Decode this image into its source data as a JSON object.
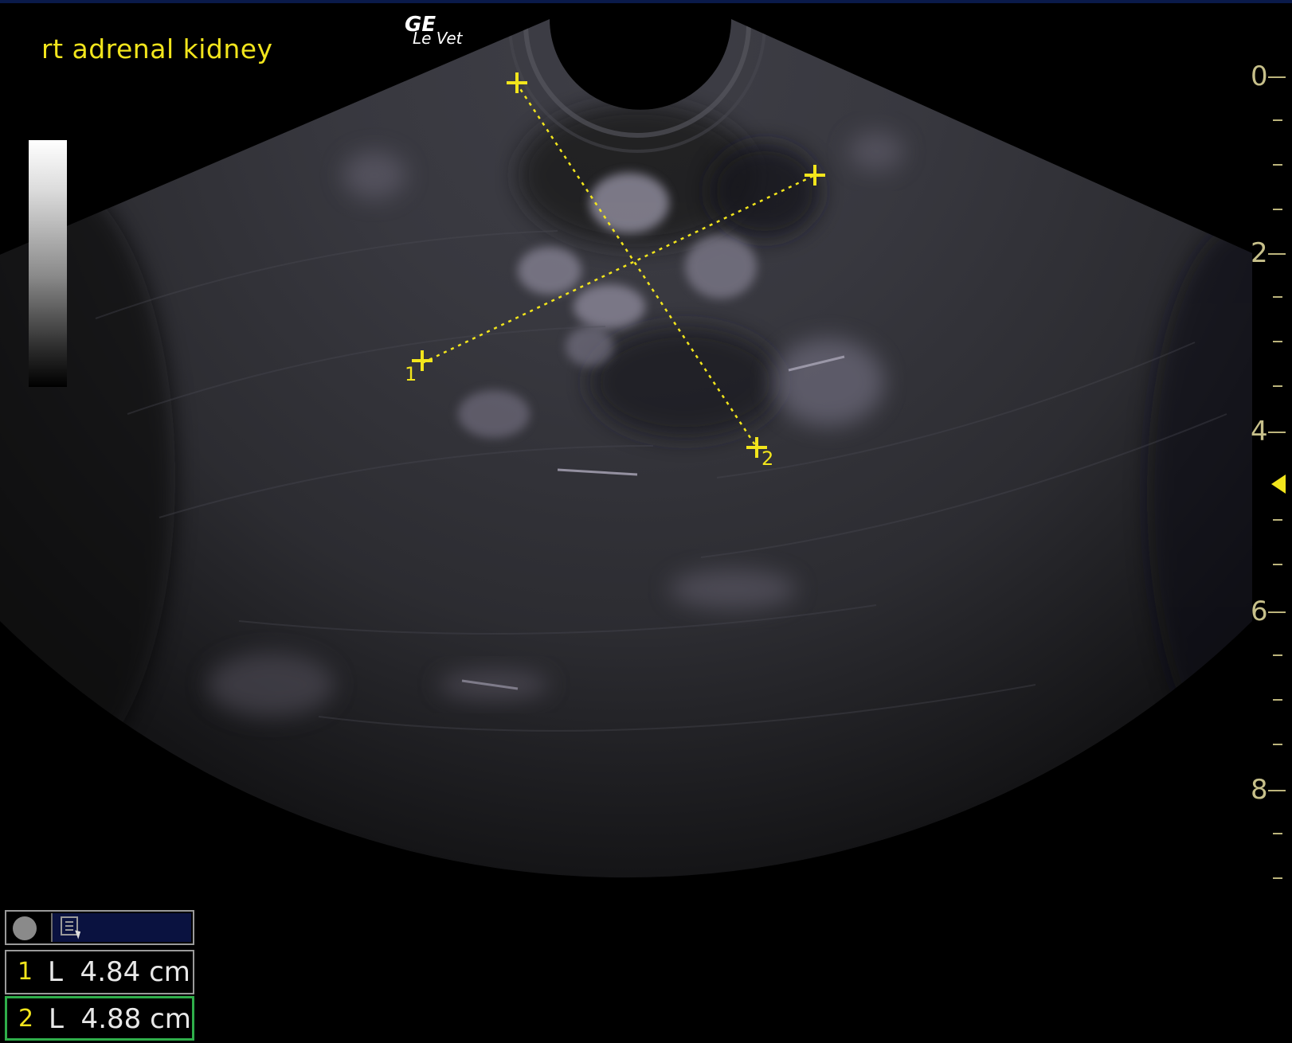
{
  "annotation": {
    "label": "rt adrenal kidney"
  },
  "logo": {
    "brand": "GE",
    "model": "Le Vet"
  },
  "depth_scale": {
    "labels": [
      "0",
      "2",
      "4",
      "6",
      "8"
    ]
  },
  "markers": {
    "m1": "1",
    "m2": "2"
  },
  "measurements": [
    {
      "index": "1",
      "text": "L  4.84 cm"
    },
    {
      "index": "2",
      "text": "L  4.88 cm"
    }
  ],
  "colors": {
    "overlay": "#f2e51c",
    "scale": "#c7c08a",
    "selected_border": "#2fae4a"
  },
  "icons": {
    "record": "circle-icon",
    "measure_tool": "calc-cursor-icon"
  }
}
